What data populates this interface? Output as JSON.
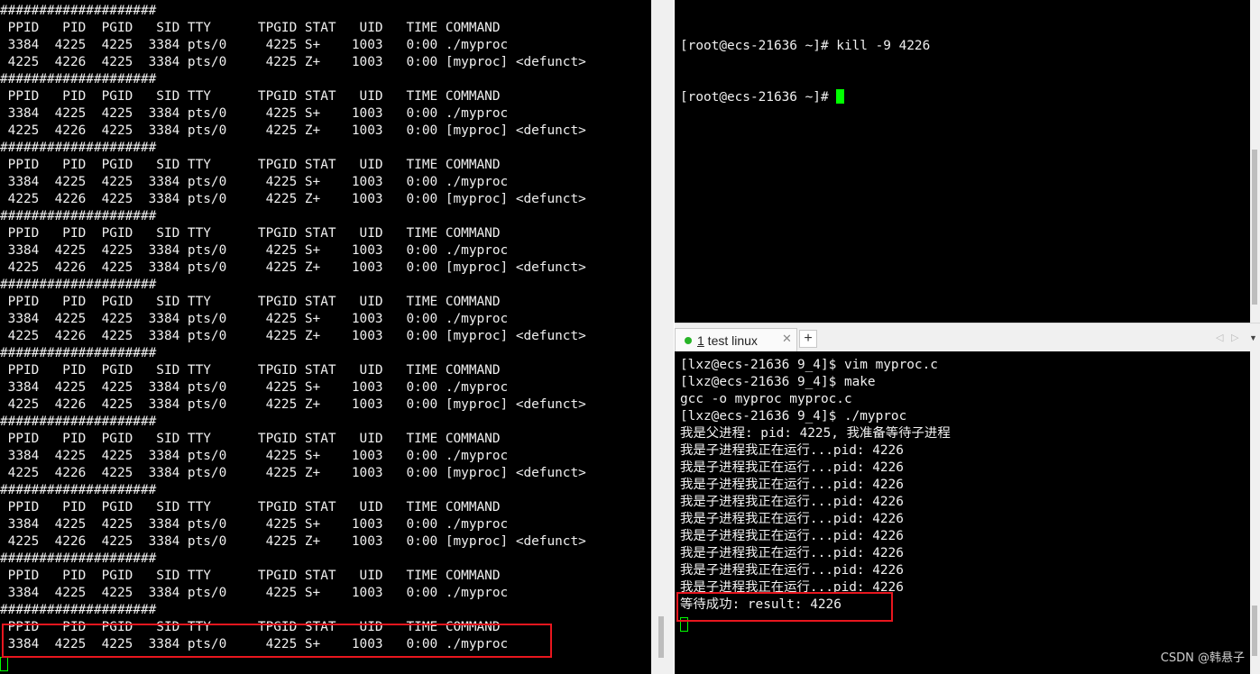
{
  "left_terminal": {
    "lines": [
      "####################",
      " PPID   PID  PGID   SID TTY      TPGID STAT   UID   TIME COMMAND",
      " 3384  4225  4225  3384 pts/0     4225 S+    1003   0:00 ./myproc",
      " 4225  4226  4225  3384 pts/0     4225 Z+    1003   0:00 [myproc] <defunct>",
      "####################",
      " PPID   PID  PGID   SID TTY      TPGID STAT   UID   TIME COMMAND",
      " 3384  4225  4225  3384 pts/0     4225 S+    1003   0:00 ./myproc",
      " 4225  4226  4225  3384 pts/0     4225 Z+    1003   0:00 [myproc] <defunct>",
      "####################",
      " PPID   PID  PGID   SID TTY      TPGID STAT   UID   TIME COMMAND",
      " 3384  4225  4225  3384 pts/0     4225 S+    1003   0:00 ./myproc",
      " 4225  4226  4225  3384 pts/0     4225 Z+    1003   0:00 [myproc] <defunct>",
      "####################",
      " PPID   PID  PGID   SID TTY      TPGID STAT   UID   TIME COMMAND",
      " 3384  4225  4225  3384 pts/0     4225 S+    1003   0:00 ./myproc",
      " 4225  4226  4225  3384 pts/0     4225 Z+    1003   0:00 [myproc] <defunct>",
      "####################",
      " PPID   PID  PGID   SID TTY      TPGID STAT   UID   TIME COMMAND",
      " 3384  4225  4225  3384 pts/0     4225 S+    1003   0:00 ./myproc",
      " 4225  4226  4225  3384 pts/0     4225 Z+    1003   0:00 [myproc] <defunct>",
      "####################",
      " PPID   PID  PGID   SID TTY      TPGID STAT   UID   TIME COMMAND",
      " 3384  4225  4225  3384 pts/0     4225 S+    1003   0:00 ./myproc",
      " 4225  4226  4225  3384 pts/0     4225 Z+    1003   0:00 [myproc] <defunct>",
      "####################",
      " PPID   PID  PGID   SID TTY      TPGID STAT   UID   TIME COMMAND",
      " 3384  4225  4225  3384 pts/0     4225 S+    1003   0:00 ./myproc",
      " 4225  4226  4225  3384 pts/0     4225 Z+    1003   0:00 [myproc] <defunct>",
      "####################",
      " PPID   PID  PGID   SID TTY      TPGID STAT   UID   TIME COMMAND",
      " 3384  4225  4225  3384 pts/0     4225 S+    1003   0:00 ./myproc",
      " 4225  4226  4225  3384 pts/0     4225 Z+    1003   0:00 [myproc] <defunct>",
      "####################",
      " PPID   PID  PGID   SID TTY      TPGID STAT   UID   TIME COMMAND",
      " 3384  4225  4225  3384 pts/0     4225 S+    1003   0:00 ./myproc",
      "####################",
      " PPID   PID  PGID   SID TTY      TPGID STAT   UID   TIME COMMAND",
      " 3384  4225  4225  3384 pts/0     4225 S+    1003   0:00 ./myproc"
    ]
  },
  "top_right_terminal": {
    "line1": "[root@ecs-21636 ~]# kill -9 4226",
    "line2": "[root@ecs-21636 ~]# "
  },
  "tab_bar": {
    "tab_number": "1",
    "tab_label": " test linux",
    "close_glyph": "✕",
    "add_glyph": "+",
    "nav_left": "◁",
    "nav_right": "▷",
    "nav_menu": "▼"
  },
  "bottom_right_terminal": {
    "lines": [
      "[lxz@ecs-21636 9_4]$ vim myproc.c",
      "[lxz@ecs-21636 9_4]$ make",
      "gcc -o myproc myproc.c",
      "[lxz@ecs-21636 9_4]$ ./myproc",
      "我是父进程: pid: 4225, 我准备等待子进程",
      "我是子进程我正在运行...pid: 4226",
      "我是子进程我正在运行...pid: 4226",
      "我是子进程我正在运行...pid: 4226",
      "我是子进程我正在运行...pid: 4226",
      "我是子进程我正在运行...pid: 4226",
      "我是子进程我正在运行...pid: 4226",
      "我是子进程我正在运行...pid: 4226",
      "我是子进程我正在运行...pid: 4226",
      "我是子进程我正在运行...pid: 4226",
      "等待成功: result: 4226"
    ]
  },
  "watermark": "CSDN @韩悬子",
  "colors": {
    "terminal_bg": "#000000",
    "terminal_fg": "#f0f0f0",
    "cursor": "#00ff00",
    "highlight_box": "#e8161e",
    "tab_dot": "#28b428"
  }
}
